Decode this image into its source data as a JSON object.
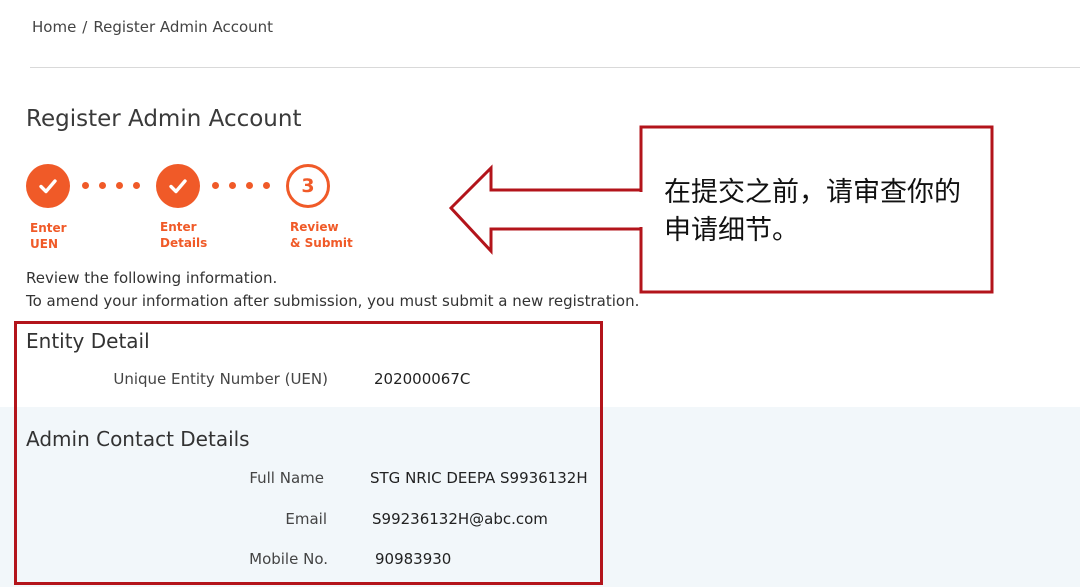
{
  "breadcrumb": {
    "home": "Home",
    "separator": "/",
    "current": "Register Admin Account"
  },
  "page_title": "Register Admin Account",
  "stepper": {
    "steps": [
      {
        "label": "Enter\nUEN",
        "state": "done"
      },
      {
        "label": "Enter\nDetails",
        "state": "done"
      },
      {
        "label": "Review\n& Submit",
        "state": "current",
        "number": "3"
      }
    ],
    "accent_color": "#f05a28"
  },
  "intro": {
    "line1": "Review the following information.",
    "line2": "To amend your information after submission, you must submit a new registration."
  },
  "entity_detail": {
    "title": "Entity Detail",
    "uen_label": "Unique Entity Number (UEN)",
    "uen_value": "202000067C"
  },
  "admin_contact": {
    "title": "Admin Contact Details",
    "full_name_label": "Full Name",
    "full_name_value": "STG NRIC DEEPA S9936132H",
    "email_label": "Email",
    "email_value": "S99236132H@abc.com",
    "mobile_label": "Mobile No.",
    "mobile_value": "90983930"
  },
  "callout": {
    "text": "在提交之前，请审查你的申请细节。",
    "border_color": "#b3141b"
  },
  "icons": {
    "check": "check-icon"
  }
}
